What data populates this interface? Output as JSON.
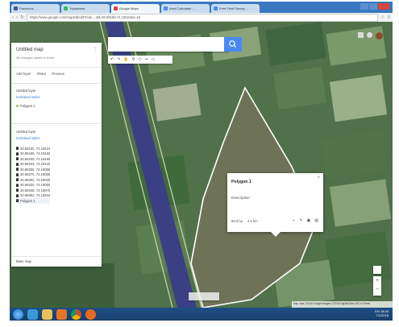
{
  "browser": {
    "tabs": [
      {
        "label": "Facebook - ...",
        "color": "#3b5998"
      },
      {
        "label": "Tripadvisor",
        "color": "#2bbd5c"
      },
      {
        "label": "Google Maps",
        "color": "#e0453b"
      },
      {
        "label": "Area Calculator ...",
        "color": "#4a89f3"
      },
      {
        "label": "Free Field Survey ...",
        "color": "#4a89f3"
      }
    ],
    "url": "https://www.google.com/maps/d/edit?mid=...&ll=30.69150,74.19224&z=16"
  },
  "panel": {
    "title": "Untitled map",
    "subtitle": "All changes saved in Drive",
    "actions": [
      "Add layer",
      "Share",
      "Preview"
    ],
    "layer1": {
      "title": "Untitled layer",
      "style": "Individual styles",
      "items": [
        "Polygon 1"
      ]
    },
    "layer2": {
      "title": "Untitled layer",
      "style": "Individual styles",
      "items": [
        "30.69150, 74.19224",
        "30.69186, 74.19183",
        "30.69200, 74.19160",
        "30.69243, 74.19118",
        "30.69255, 74.19090",
        "30.69270, 74.19055",
        "30.69302, 74.19030",
        "30.69320, 74.19000",
        "30.69345, 74.18970",
        "30.69362, 74.18944",
        "Polygon 1"
      ]
    },
    "basemap": "Base map"
  },
  "toolbar": {
    "icons": [
      "undo-icon",
      "redo-icon",
      "hand-icon",
      "marker-icon",
      "polygon-icon",
      "route-icon",
      "ruler-icon"
    ]
  },
  "infowindow": {
    "title": "Polygon 1",
    "body": "Description",
    "area": "88.5 ha",
    "perimeter": "4.6 km"
  },
  "map": {
    "attribution": "Map data ©2018 Google  Imagery ©2018 DigitalGlobe  200 m  Terms"
  },
  "taskbar": {
    "apps": [
      "start",
      "ie",
      "explorer",
      "media",
      "chrome",
      "firefox"
    ],
    "time": "18:26",
    "date": "7/1/2018",
    "lang": "EN"
  },
  "colors": {
    "search_button": "#4a89f3",
    "canal": "#3b3f83",
    "polygon_outline": "#ffffff",
    "taskbar": "#1e4f86",
    "chrome_close": "#d9463b"
  }
}
